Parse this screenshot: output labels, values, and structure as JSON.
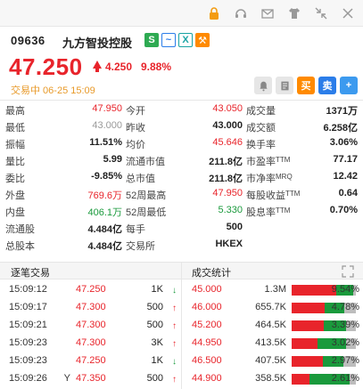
{
  "stock": {
    "code": "09636",
    "name": "九方智投控股",
    "price": "47.250",
    "change": "4.250",
    "change_pct": "9.88%",
    "status": "交易中 06-25 15:09"
  },
  "badges": [
    "S",
    "~",
    "X",
    "⚒"
  ],
  "actions": {
    "buy": "买",
    "sell": "卖",
    "add": "+"
  },
  "stats": [
    {
      "l1": "最高",
      "v1": "47.950",
      "c1": "red",
      "l2": "今开",
      "v2": "43.050",
      "c2": "red",
      "l3": "成交量",
      "v3": "1371万",
      "c3": "bold"
    },
    {
      "l1": "最低",
      "v1": "43.000",
      "c1": "gray",
      "l2": "昨收",
      "v2": "43.000",
      "c2": "bold",
      "l3": "成交额",
      "v3": "6.258亿",
      "c3": "bold"
    },
    {
      "l1": "振幅",
      "v1": "11.51%",
      "c1": "bold",
      "l2": "均价",
      "v2": "45.646",
      "c2": "red",
      "l3": "换手率",
      "v3": "3.06%",
      "c3": "bold"
    },
    {
      "l1": "量比",
      "v1": "5.99",
      "c1": "bold",
      "l2": "流通市值",
      "v2": "211.8亿",
      "c2": "bold",
      "l3": "市盈率TTM",
      "v3": "77.17",
      "c3": "bold"
    },
    {
      "l1": "委比",
      "v1": "-9.85%",
      "c1": "bold",
      "l2": "总市值",
      "v2": "211.8亿",
      "c2": "bold",
      "l3": "市净率MRQ",
      "v3": "12.42",
      "c3": "bold"
    },
    {
      "l1": "外盘",
      "v1": "769.6万",
      "c1": "red",
      "l2": "52周最高",
      "v2": "47.950",
      "c2": "red",
      "l3": "每股收益TTM",
      "v3": "0.64",
      "c3": "bold"
    },
    {
      "l1": "内盘",
      "v1": "406.1万",
      "c1": "green",
      "l2": "52周最低",
      "v2": "5.330",
      "c2": "green",
      "l3": "股息率TTM",
      "v3": "0.70%",
      "c3": "bold"
    },
    {
      "l1": "流通股",
      "v1": "4.484亿",
      "c1": "bold",
      "l2": "每手",
      "v2": "500",
      "c2": "bold",
      "l3": "",
      "v3": "",
      "c3": "bold"
    },
    {
      "l1": "总股本",
      "v1": "4.484亿",
      "c1": "bold",
      "l2": "交易所",
      "v2": "HKEX",
      "c2": "bold",
      "l3": "",
      "v3": "",
      "c3": "bold"
    }
  ],
  "trades_header": {
    "left": "逐笔交易",
    "right": "成交统计"
  },
  "trades": [
    {
      "time": "15:09:12",
      "price": "47.250",
      "pc": "red",
      "vol": "1K",
      "dir": "down",
      "flag": ""
    },
    {
      "time": "15:09:17",
      "price": "47.300",
      "pc": "red",
      "vol": "500",
      "dir": "up",
      "flag": ""
    },
    {
      "time": "15:09:21",
      "price": "47.300",
      "pc": "red",
      "vol": "500",
      "dir": "up",
      "flag": ""
    },
    {
      "time": "15:09:23",
      "price": "47.300",
      "pc": "red",
      "vol": "3K",
      "dir": "up",
      "flag": ""
    },
    {
      "time": "15:09:23",
      "price": "47.250",
      "pc": "red",
      "vol": "1K",
      "dir": "down",
      "flag": ""
    },
    {
      "time": "15:09:26",
      "price": "47.350",
      "pc": "red",
      "vol": "500",
      "dir": "up",
      "flag": "Y"
    }
  ],
  "volume_stats": [
    {
      "price": "45.000",
      "vol": "1.3M",
      "pct": "9.54%",
      "red": 0.7,
      "green": 0.26,
      "gray": 0.04
    },
    {
      "price": "46.000",
      "vol": "655.7K",
      "pct": "4.78%",
      "red": 0.52,
      "green": 0.3,
      "gray": 0.18
    },
    {
      "price": "45.200",
      "vol": "464.5K",
      "pct": "3.39%",
      "red": 0.5,
      "green": 0.35,
      "gray": 0.15
    },
    {
      "price": "44.950",
      "vol": "413.5K",
      "pct": "3.02%",
      "red": 0.4,
      "green": 0.45,
      "gray": 0.15
    },
    {
      "price": "46.500",
      "vol": "407.5K",
      "pct": "2.97%",
      "red": 0.48,
      "green": 0.32,
      "gray": 0.2
    },
    {
      "price": "44.900",
      "vol": "358.5K",
      "pct": "2.61%",
      "red": 0.28,
      "green": 0.62,
      "gray": 0.1
    }
  ],
  "icons": [
    "lock-icon",
    "support-icon",
    "mail-icon",
    "shirt-icon",
    "collapse-icon",
    "expand-icon",
    "close-icon",
    "bell-icon",
    "note-icon",
    "buy-icon",
    "sell-icon",
    "add-icon"
  ]
}
